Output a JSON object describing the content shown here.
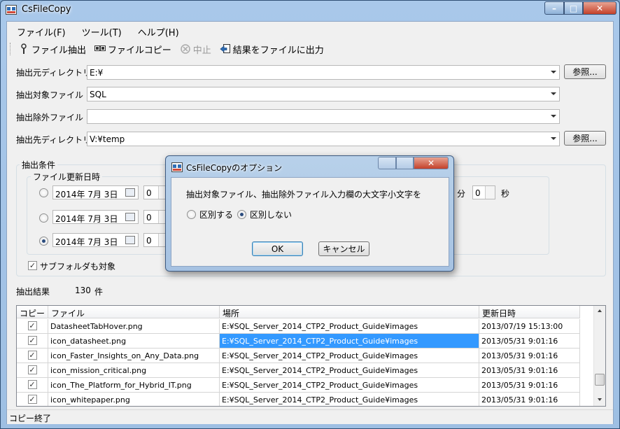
{
  "window": {
    "title": "CsFileCopy"
  },
  "menu": [
    "ファイル(F)",
    "ツール(T)",
    "ヘルプ(H)"
  ],
  "toolbar": {
    "extract": "ファイル抽出",
    "copy": "ファイルコピー",
    "stop": "中止",
    "output": "結果をファイルに出力"
  },
  "form": {
    "source_label": "抽出元ディレクトリ",
    "source_value": "E:¥",
    "target_label": "抽出対象ファイル",
    "target_value": "SQL",
    "exclude_label": "抽出除外ファイル",
    "exclude_value": "",
    "dest_label": "抽出先ディレクトリ",
    "dest_value": "V:¥temp",
    "browse": "参照..."
  },
  "conditions": {
    "group_title": "抽出条件",
    "date_group_title": "ファイル更新日時",
    "rows": [
      {
        "date": "2014年  7月  3日",
        "value": "0"
      },
      {
        "date": "2014年  7月  3日",
        "value": "0"
      },
      {
        "date": "2014年  7月  3日",
        "value": "0"
      }
    ],
    "minute_label": "分",
    "minute_value": "0",
    "second_label": "秒",
    "subfolder_label": "サブフォルダも対象"
  },
  "results": {
    "label": "抽出結果",
    "count": "130",
    "unit": "件"
  },
  "grid": {
    "headers": [
      "コピー",
      "ファイル",
      "場所",
      "更新日時"
    ],
    "rows": [
      {
        "file": "DatasheetTabHover.png",
        "location": "E:¥SQL_Server_2014_CTP2_Product_Guide¥images",
        "date": "2013/07/19 15:13:00"
      },
      {
        "file": "icon_datasheet.png",
        "location": "E:¥SQL_Server_2014_CTP2_Product_Guide¥images",
        "date": "2013/05/31 9:01:16"
      },
      {
        "file": "icon_Faster_Insights_on_Any_Data.png",
        "location": "E:¥SQL_Server_2014_CTP2_Product_Guide¥images",
        "date": "2013/05/31 9:01:16"
      },
      {
        "file": "icon_mission_critical.png",
        "location": "E:¥SQL_Server_2014_CTP2_Product_Guide¥images",
        "date": "2013/05/31 9:01:16"
      },
      {
        "file": "icon_The_Platform_for_Hybrid_IT.png",
        "location": "E:¥SQL_Server_2014_CTP2_Product_Guide¥images",
        "date": "2013/05/31 9:01:16"
      },
      {
        "file": "icon_whitepaper.png",
        "location": "E:¥SQL_Server_2014_CTP2_Product_Guide¥images",
        "date": "2013/05/31 9:01:16"
      }
    ]
  },
  "status": "コピー終了",
  "dialog": {
    "title": "CsFileCopyのオプション",
    "message": "抽出対象ファイル、抽出除外ファイル入力欄の大文字小文字を",
    "option_distinguish": "区別する",
    "option_ignore": "区別しない",
    "ok": "OK",
    "cancel": "キャンセル"
  },
  "colors": {
    "selection": "#3399ff",
    "frame": "#a9c8ea",
    "close_button": "#c4412a"
  }
}
